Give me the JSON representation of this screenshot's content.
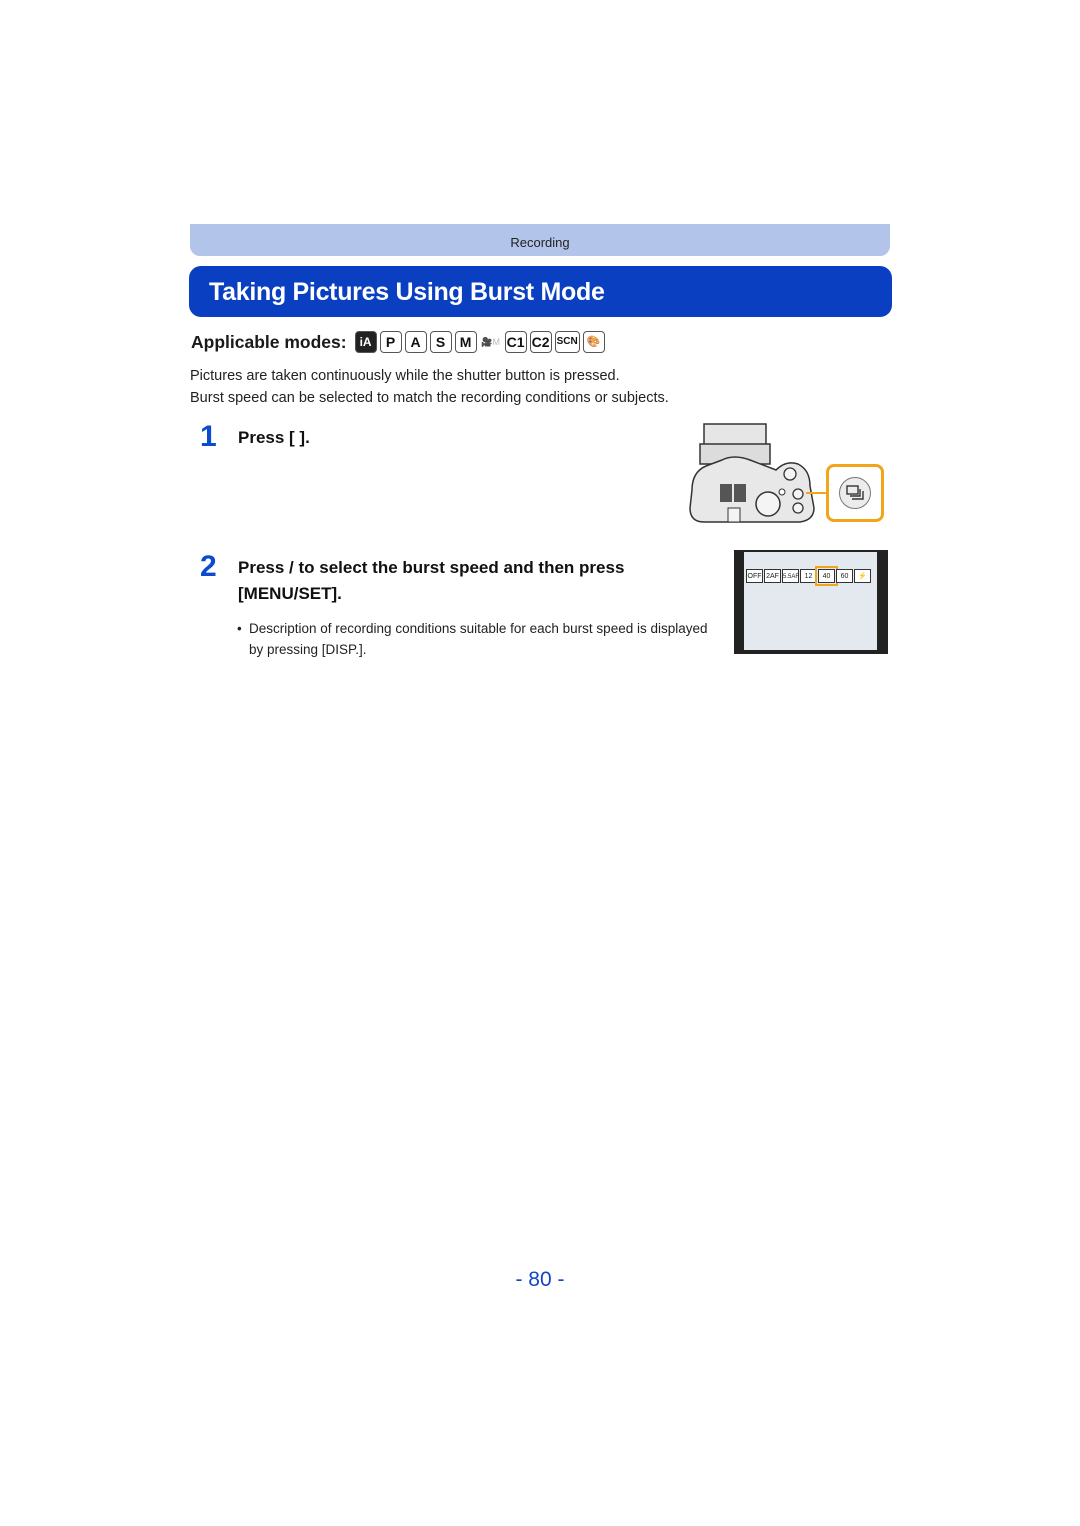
{
  "header": {
    "section_label": "Recording",
    "title": "Taking Pictures Using Burst Mode"
  },
  "modes": {
    "label": "Applicable modes:",
    "items": [
      {
        "name": "intelligent-auto",
        "text": "iA",
        "enabled": true
      },
      {
        "name": "program",
        "text": "P",
        "enabled": true
      },
      {
        "name": "aperture-priority",
        "text": "A",
        "enabled": true
      },
      {
        "name": "shutter-priority",
        "text": "S",
        "enabled": true
      },
      {
        "name": "manual",
        "text": "M",
        "enabled": true
      },
      {
        "name": "creative-video",
        "text": "🎥M",
        "enabled": false
      },
      {
        "name": "custom-1",
        "text": "C1",
        "enabled": true
      },
      {
        "name": "custom-2",
        "text": "C2",
        "enabled": true
      },
      {
        "name": "scene",
        "text": "SCN",
        "enabled": true
      },
      {
        "name": "creative-control",
        "text": "🎨",
        "enabled": true
      }
    ]
  },
  "intro": {
    "line1": "Pictures are taken continuously while the shutter button is pressed.",
    "line2": "Burst speed can be selected to match the recording conditions or subjects."
  },
  "steps": [
    {
      "number": "1",
      "text": "Press [     ]."
    },
    {
      "number": "2",
      "text_line1": "Press    /     to select the burst speed and then press",
      "text_line2": "[MENU/SET].",
      "note_bullet": "•",
      "note": "Description of recording conditions suitable for each burst speed is displayed by pressing [DISP.]."
    }
  ],
  "burst_options": [
    {
      "label": "OFF",
      "selected": false
    },
    {
      "label": "2AF",
      "selected": false
    },
    {
      "label": "5.5AF",
      "selected": false
    },
    {
      "label": "12",
      "selected": false
    },
    {
      "label": "40",
      "selected": true
    },
    {
      "label": "60",
      "selected": false
    },
    {
      "label": "⚡",
      "selected": false
    }
  ],
  "colors": {
    "accent_blue": "#0a3fc2",
    "tab_blue": "#b3c4ea",
    "highlight_orange": "#f2a51a",
    "page_number_blue": "#1444c8"
  },
  "footer": {
    "page_number": "- 80 -"
  }
}
